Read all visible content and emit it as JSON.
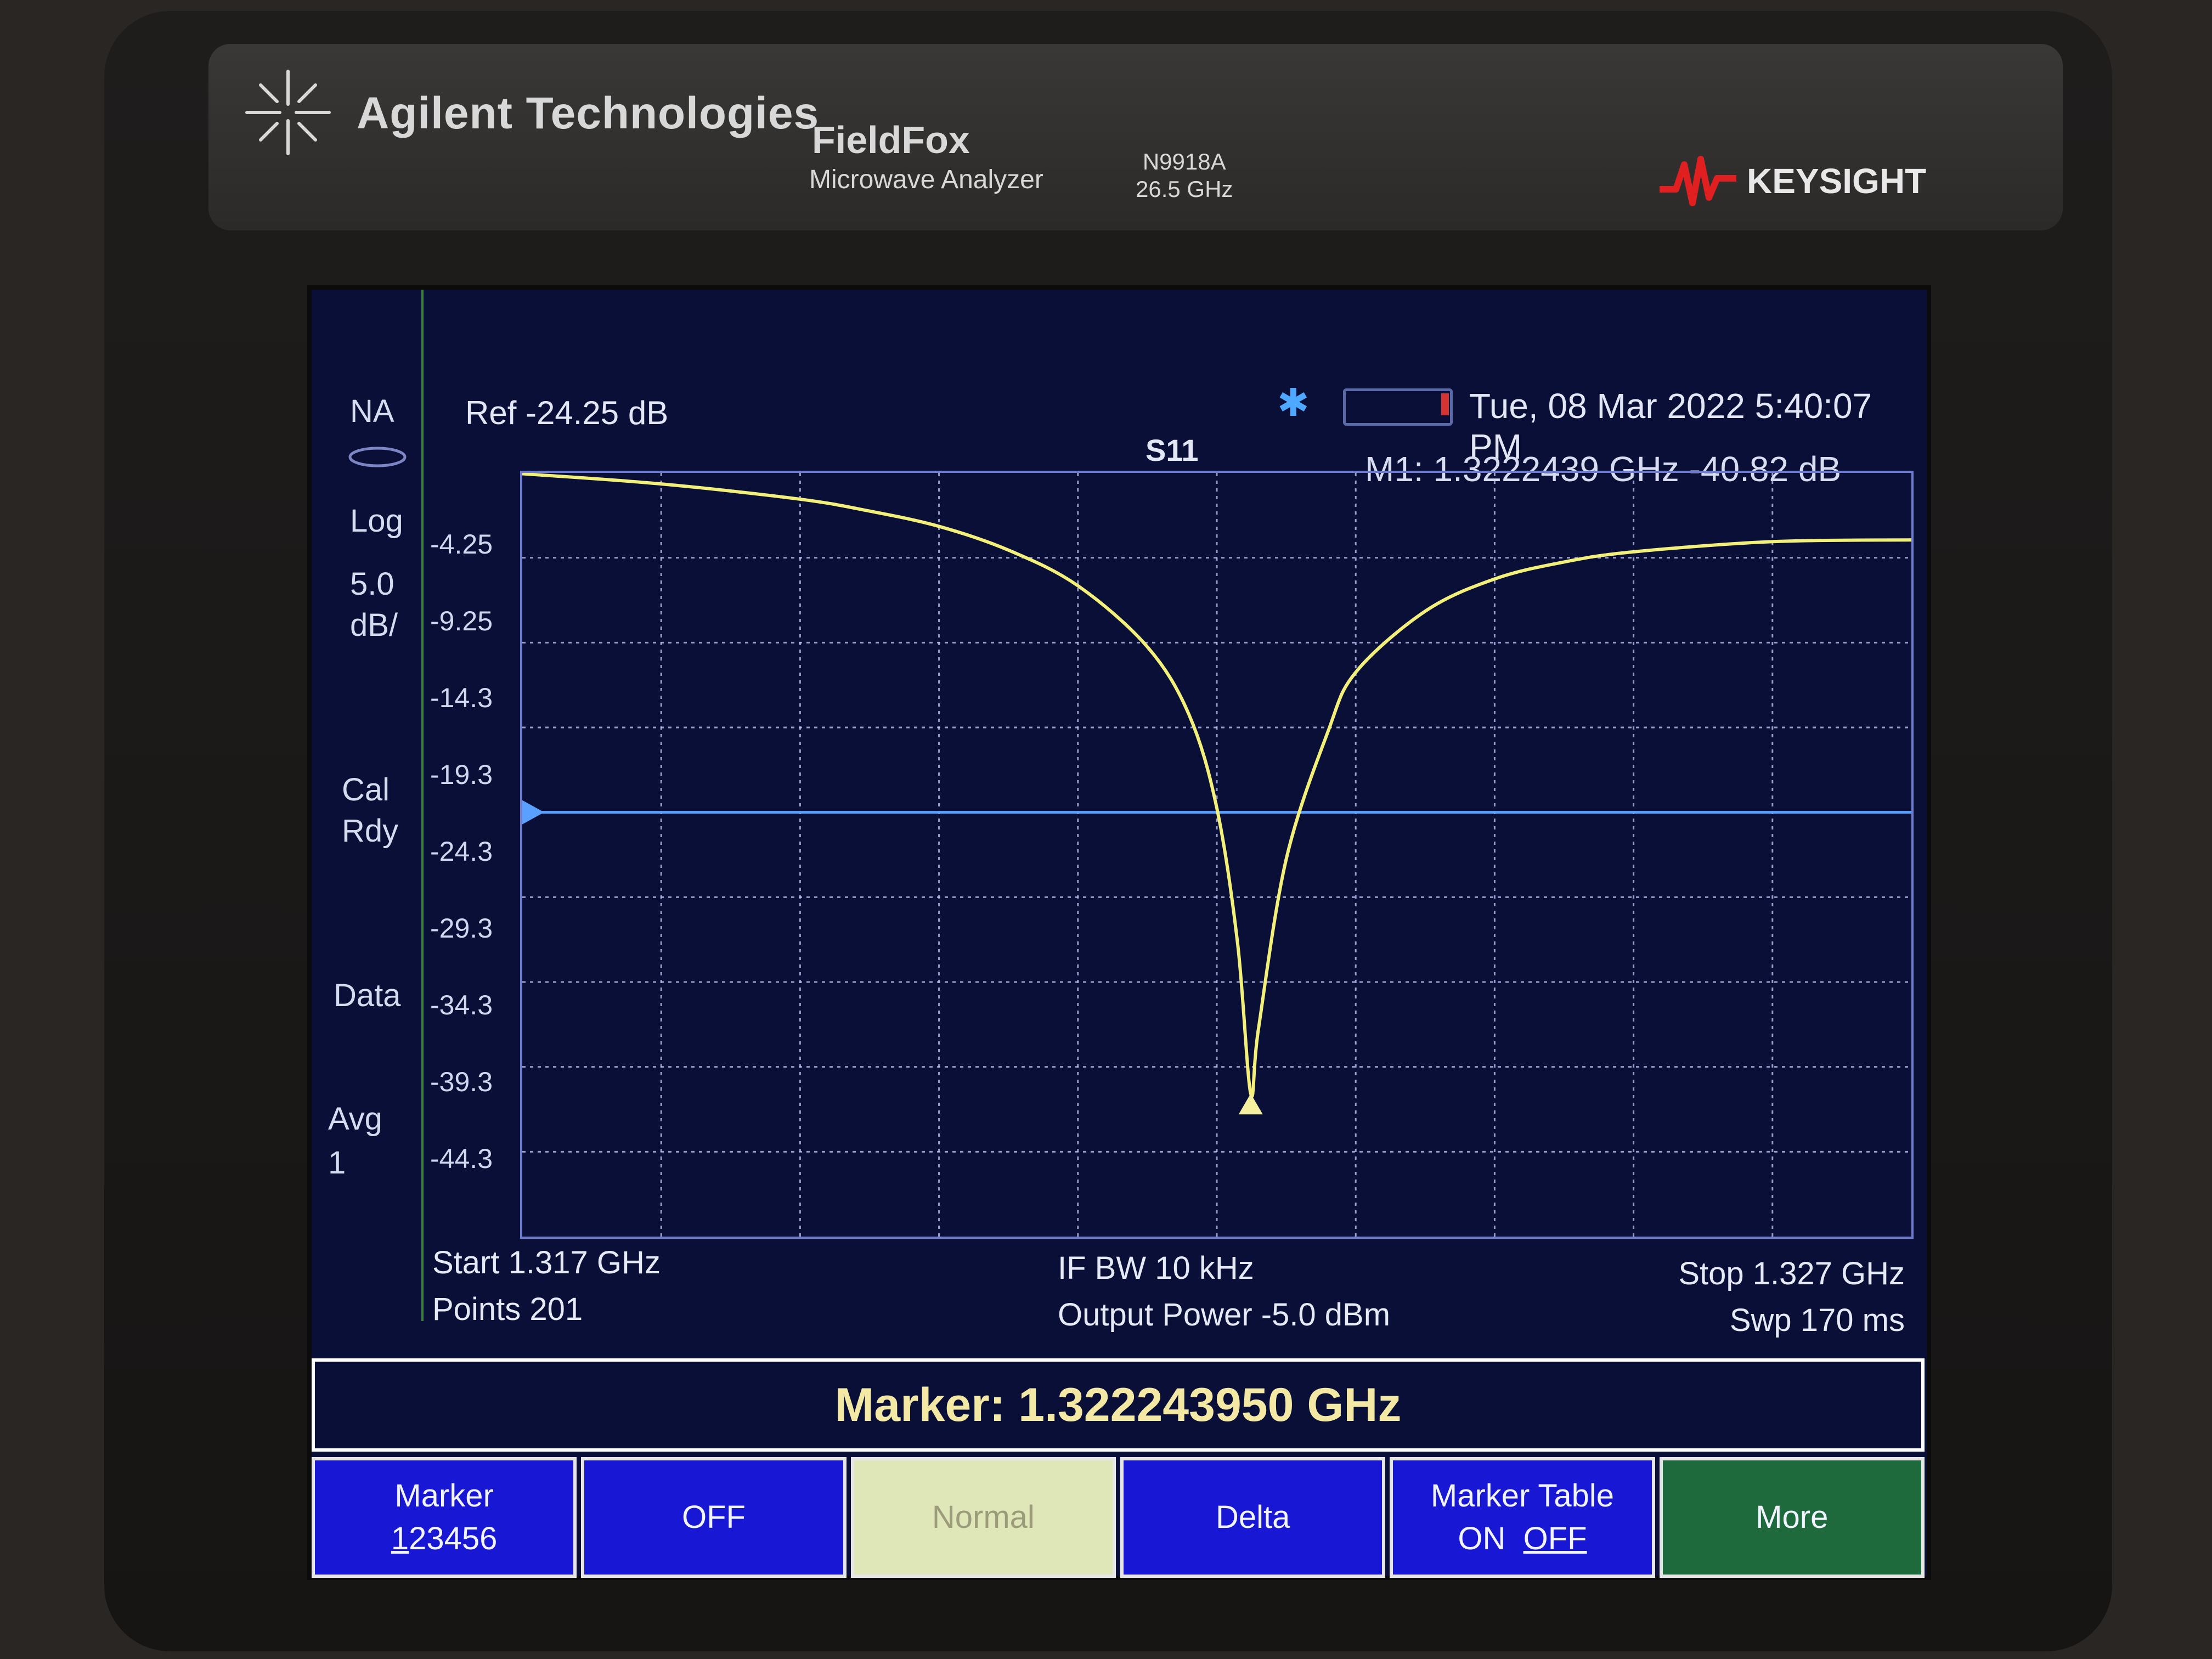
{
  "device": {
    "maker": "Agilent Technologies",
    "product": "FieldFox",
    "product_sub": "Microwave Analyzer",
    "model": "N9918A",
    "freq_range": "26.5 GHz",
    "brand": "KEYSIGHT"
  },
  "status": {
    "mode": "NA",
    "ref": "Ref -24.25 dB",
    "trace": "S11",
    "datetime": "Tue, 08 Mar 2022 5:40:07 PM",
    "marker_readout": "M1:  1.3222439 GHz  -40.82 dB",
    "format": "Log",
    "scale_value": "5.0",
    "scale_unit": "dB/",
    "cal_line1": "Cal",
    "cal_line2": "Rdy",
    "data": "Data",
    "avg_label": "Avg",
    "avg_value": "1"
  },
  "chart_data": {
    "type": "line",
    "title": "S11",
    "y_ticks": [
      "-4.25",
      "-9.25",
      "-14.3",
      "-19.3",
      "-24.3",
      "-29.3",
      "-34.3",
      "-39.3",
      "-44.3"
    ],
    "ylim": [
      -49.25,
      -4.25
    ],
    "xlim": [
      1.317,
      1.327
    ],
    "x_unit": "GHz",
    "reference_level": -24.25,
    "grid": true,
    "series": [
      {
        "color": "#f2ef7a",
        "x": [
          1.317,
          1.318,
          1.319,
          1.3195,
          1.32,
          1.3205,
          1.321,
          1.3215,
          1.3218,
          1.322,
          1.32215,
          1.3222439,
          1.3223,
          1.3225,
          1.3228,
          1.323,
          1.3235,
          1.324,
          1.3245,
          1.325,
          1.326,
          1.327
        ],
        "y": [
          -4.3,
          -4.9,
          -5.8,
          -6.5,
          -7.4,
          -8.8,
          -10.9,
          -14.5,
          -18.5,
          -24.0,
          -32.0,
          -40.82,
          -37.0,
          -27.0,
          -19.5,
          -16.0,
          -12.4,
          -10.5,
          -9.5,
          -8.9,
          -8.3,
          -8.2
        ]
      }
    ],
    "marker": {
      "x": 1.3222439,
      "y": -40.82
    }
  },
  "footer": {
    "start": "Start 1.317 GHz",
    "points": "Points 201",
    "ifbw": "IF BW 10 kHz",
    "power": "Output Power -5.0 dBm",
    "stop": "Stop 1.327 GHz",
    "sweep": "Swp 170 ms"
  },
  "marker_bar": "Marker:  1.322243950 GHz",
  "softkeys": {
    "marker_title": "Marker",
    "marker_selected": "1",
    "marker_rest": "23456",
    "off": "OFF",
    "normal": "Normal",
    "delta": "Delta",
    "table_title": "Marker Table",
    "table_on": "ON",
    "table_off": "OFF",
    "more": "More"
  }
}
